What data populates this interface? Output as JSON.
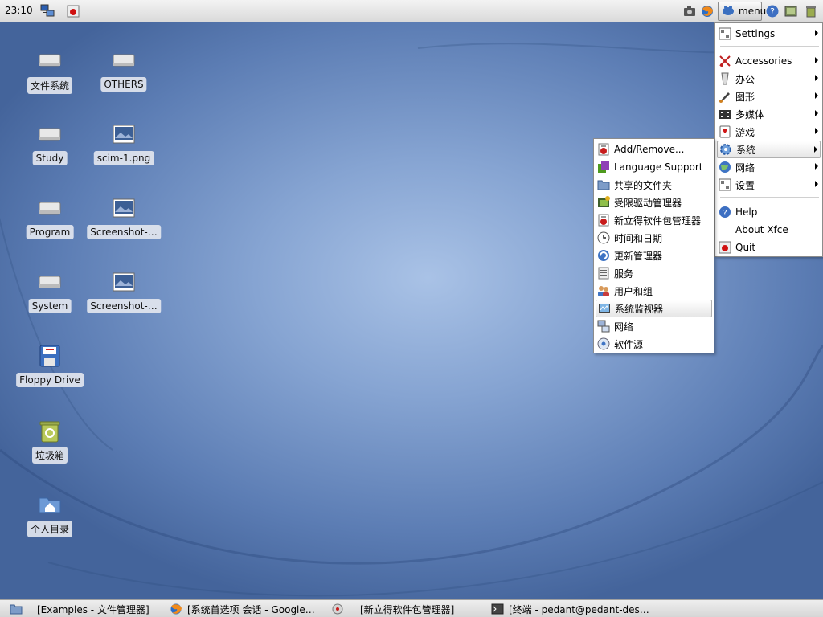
{
  "top_panel": {
    "clock": "23:10",
    "menu_label": "menu"
  },
  "desktop_icons": [
    {
      "label": "文件系统",
      "icon": "drive-icon"
    },
    {
      "label": "OTHERS",
      "icon": "drive-icon"
    },
    {
      "label": "Study",
      "icon": "drive-icon"
    },
    {
      "label": "scim-1.png",
      "icon": "image-file-icon"
    },
    {
      "label": "Program",
      "icon": "drive-icon"
    },
    {
      "label": "Screenshot-…",
      "icon": "image-file-icon"
    },
    {
      "label": "System",
      "icon": "drive-icon"
    },
    {
      "label": "Screenshot-…",
      "icon": "image-file-icon"
    },
    {
      "label": "Floppy Drive",
      "icon": "floppy-icon"
    },
    {
      "label": "垃圾箱",
      "icon": "trash-icon"
    },
    {
      "label": "个人目录",
      "icon": "home-folder-icon"
    }
  ],
  "main_menu": {
    "items": [
      {
        "label": "Settings",
        "icon": "settings-icon",
        "submenu": true
      },
      {
        "label": "Accessories",
        "icon": "accessories-icon",
        "submenu": true
      },
      {
        "label": "办公",
        "icon": "office-icon",
        "submenu": true
      },
      {
        "label": "图形",
        "icon": "graphics-icon",
        "submenu": true
      },
      {
        "label": "多媒体",
        "icon": "multimedia-icon",
        "submenu": true
      },
      {
        "label": "游戏",
        "icon": "games-icon",
        "submenu": true
      },
      {
        "label": "系统",
        "icon": "system-icon",
        "submenu": true,
        "selected": true
      },
      {
        "label": "网络",
        "icon": "network-icon",
        "submenu": true
      },
      {
        "label": "设置",
        "icon": "settings-icon",
        "submenu": true
      },
      {
        "label": "Help",
        "icon": "help-icon",
        "submenu": false
      },
      {
        "label": "About Xfce",
        "icon": "",
        "submenu": false
      },
      {
        "label": "Quit",
        "icon": "quit-icon",
        "submenu": false
      }
    ]
  },
  "system_submenu": {
    "items": [
      {
        "label": "Add/Remove...",
        "icon": "add-remove-icon"
      },
      {
        "label": "Language Support",
        "icon": "language-icon"
      },
      {
        "label": "共享的文件夹",
        "icon": "shared-folder-icon"
      },
      {
        "label": "受限驱动管理器",
        "icon": "driver-icon"
      },
      {
        "label": "新立得软件包管理器",
        "icon": "package-manager-icon"
      },
      {
        "label": "时间和日期",
        "icon": "clock-icon"
      },
      {
        "label": "更新管理器",
        "icon": "update-icon"
      },
      {
        "label": "服务",
        "icon": "services-icon"
      },
      {
        "label": "用户和组",
        "icon": "users-icon"
      },
      {
        "label": "系统监视器",
        "icon": "monitor-icon",
        "selected": true
      },
      {
        "label": "网络",
        "icon": "network-icon"
      },
      {
        "label": "软件源",
        "icon": "sources-icon"
      }
    ]
  },
  "taskbar": {
    "tasks": [
      {
        "label": "[Examples - 文件管理器]",
        "icon": "folder-icon"
      },
      {
        "label": "[系统首选项 会话 - Google…",
        "icon": "firefox-icon"
      },
      {
        "label": "[新立得软件包管理器]",
        "icon": "package-manager-icon"
      },
      {
        "label": "[终端 - pedant@pedant-des…",
        "icon": "terminal-icon"
      }
    ]
  }
}
